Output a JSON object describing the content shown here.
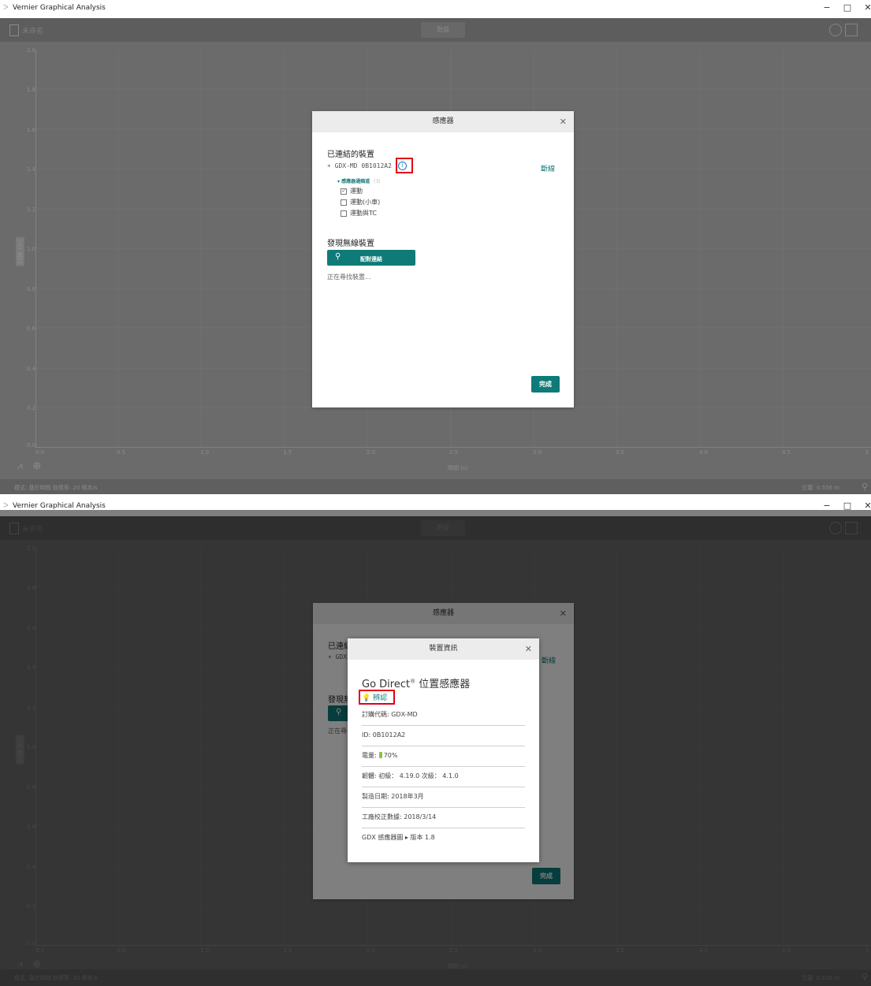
{
  "app": {
    "title": "Vernier Graphical Analysis",
    "icon": "vernier-logo-icon"
  },
  "window_controls": {
    "minimize": "−",
    "maximize": "□",
    "close": "✕"
  },
  "toolbar": {
    "file_label": "未命名",
    "mode_label": "數據"
  },
  "graph": {
    "y_ticks": [
      "2.0",
      "1.8",
      "1.6",
      "1.4",
      "1.2",
      "1.0",
      "0.8",
      "0.6",
      "0.4",
      "0.2",
      "0.0"
    ],
    "x_ticks": [
      "0.0",
      "0.5",
      "1.0",
      "1.5",
      "2.0",
      "2.5",
      "3.0",
      "3.5",
      "4.0",
      "4.5",
      "5"
    ],
    "y_label": "位置 (m)",
    "x_label": "時間 (s)"
  },
  "statusbar": {
    "left": "模式: 基於時間  取樣率: 20 樣本/s",
    "right": "位置: 0.556 m"
  },
  "sensors_dialog": {
    "title": "感應器",
    "connected_section": "已連結的裝置",
    "device_name": "GDX-MD 0B1012A2",
    "disconnect_label": "斷線",
    "channels_header": "感應器通頻道",
    "channels_count": "(3)",
    "channels": [
      {
        "label": "運動",
        "checked": true
      },
      {
        "label": "運動(小車)",
        "checked": false
      },
      {
        "label": "運動與TC",
        "checked": false
      }
    ],
    "discover_section": "發現無線裝置",
    "pair_label": "配對連結",
    "searching_text": "正在尋找裝置...",
    "done_label": "完成"
  },
  "device_info_dialog": {
    "title": "裝置資訊",
    "product_name": "Go Direct",
    "product_mark": "®",
    "product_suffix": " 位置感應器",
    "identify_label": "辨認",
    "order_code": "訂購代碼: GDX-MD",
    "id": "ID: 0B1012A2",
    "battery_label": "電量:",
    "battery_value": "70%",
    "firmware": "韌體: 初級： 4.19.0 次級： 4.1.0",
    "manufacture_date": "製造日期: 2018年3月",
    "calibration": "工廠校正數據: 2018/3/14",
    "library": "GDX 感應器圖 ▸ 版本 1.8"
  }
}
